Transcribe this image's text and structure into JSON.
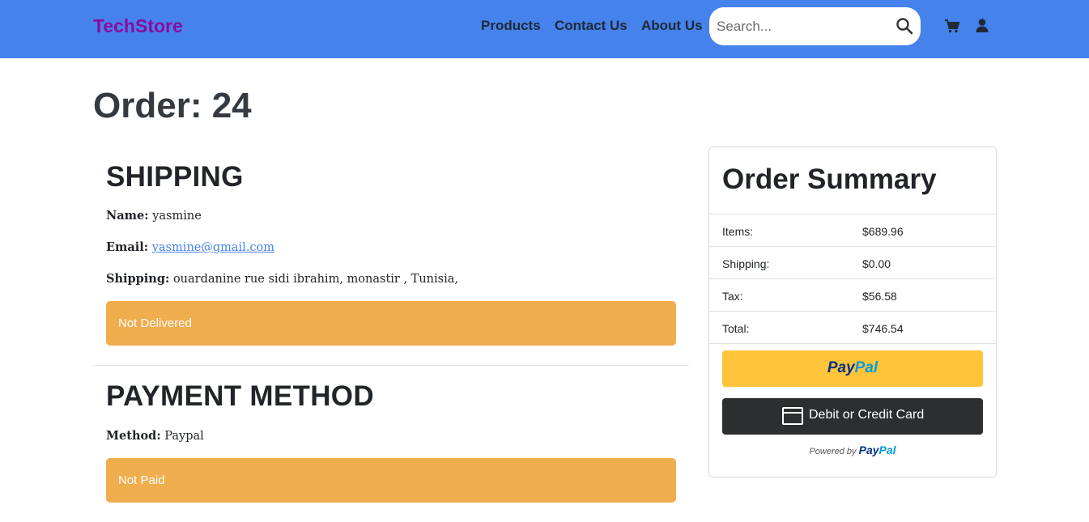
{
  "navbar": {
    "brand": "TechStore",
    "links": [
      "Products",
      "Contact Us",
      "About Us"
    ],
    "search_placeholder": "Search...",
    "icons": [
      "search-icon",
      "cart-icon",
      "user-icon"
    ],
    "bg_color": "#4582ec",
    "brand_color": "#8a0c9e"
  },
  "page": {
    "title": "Order: 24"
  },
  "shipping": {
    "heading": "SHIPPING",
    "name_label": "Name:",
    "name_value": "yasmine",
    "email_label": "Email:",
    "email_value": "yasmine@gmail.com",
    "address_label": "Shipping:",
    "address_value": "ouardanine rue sidi ibrahim, monastir , Tunisia,",
    "status": "Not Delivered"
  },
  "payment": {
    "heading": "PAYMENT METHOD",
    "method_label": "Method:",
    "method_value": "Paypal",
    "status": "Not Paid"
  },
  "summary": {
    "heading": "Order Summary",
    "rows": [
      {
        "label": "Items:",
        "value": "$689.96"
      },
      {
        "label": "Shipping:",
        "value": "$0.00"
      },
      {
        "label": "Tax:",
        "value": "$56.58"
      },
      {
        "label": "Total:",
        "value": "$746.54"
      }
    ],
    "paypal_logo": {
      "pay": "Pay",
      "pal": "Pal"
    },
    "card_button": "Debit or Credit Card",
    "powered_by": "Powered by",
    "powered_logo": {
      "pay": "Pay",
      "pal": "Pal"
    }
  },
  "colors": {
    "warning": "#f0ad4e",
    "paypal_yellow": "#ffc439",
    "paypal_dark_blue": "#003087",
    "paypal_light_blue": "#009cde",
    "card_button": "#2c2e2f"
  }
}
